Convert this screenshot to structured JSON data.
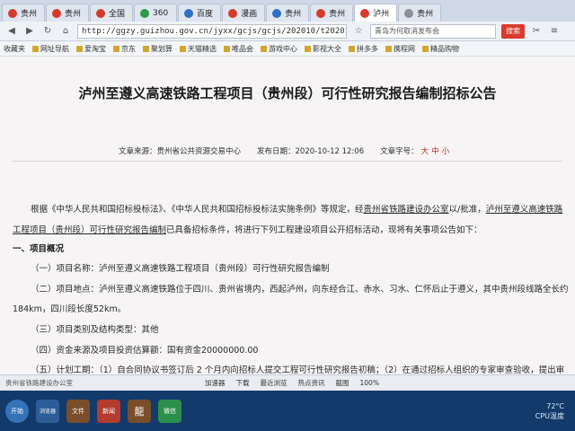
{
  "tabs": [
    {
      "label": "贵州",
      "color": "red"
    },
    {
      "label": "贵州",
      "color": "red"
    },
    {
      "label": "全国",
      "color": "red"
    },
    {
      "label": "360",
      "color": "green"
    },
    {
      "label": "百度",
      "color": "blue"
    },
    {
      "label": "漫画",
      "color": "red"
    },
    {
      "label": "贵州",
      "color": "blue"
    },
    {
      "label": "贵州",
      "color": "red"
    },
    {
      "label": "泸州",
      "color": "red"
    },
    {
      "label": "贵州",
      "color": "gray"
    }
  ],
  "nav": {
    "url": "http://ggzy.guizhou.gov.cn/jyxx/gcjs/gcjs/202010/t20201012_6399737",
    "search_placeholder": "青岛为何取消发布会",
    "search_button": "搜索"
  },
  "bookmarks": [
    "收藏夹",
    "网址导航",
    "爱淘宝",
    "京东",
    "聚划算",
    "天猫精选",
    "唯品会",
    "游戏中心",
    "影视大全",
    "拼多多",
    "携程网",
    "精品购物"
  ],
  "article": {
    "title": "泸州至遵义高速铁路工程项目（贵州段）可行性研究报告编制招标公告",
    "meta_source": "文章来源：贵州省公共资源交易中心",
    "meta_time": "发布日期：2020-10-12 12:06",
    "meta_size_label": "文章字号：",
    "size_big": "大",
    "size_mid": "中",
    "size_small": "小",
    "p1a": "根据《中华人民共和国招标投标法》、《中华人民共和国招标投标法实施条例》等规定，经",
    "p1b": "贵州省铁路建设办公室",
    "p1c": "以/批准，",
    "p1d": "泸州至遵义高速铁路",
    "p2a": "工程项目（贵州段）可行性研究报告编制",
    "p2b": "已具备招标条件，将进行下列工程建设项目公开招标活动，现将有关事项公告如下：",
    "h1": "一、项目概况",
    "i1": "（一）项目名称：泸州至遵义高速铁路工程项目（贵州段）可行性研究报告编制",
    "i2a": "（二）项目地点：泸州至遵义高速铁路位于四川、贵州省境内，西起泸州，向东经合江、赤水、习水、仁怀后止于遵义，其中贵州段线路全长约",
    "i2b": "184km，四川段长度52km。",
    "i3": "（三）项目类别及结构类型：其他",
    "i4": "（四）资金来源及项目投资估算额：国有资金20000000.00",
    "i5": "（五）计划工期：（1）自合同协议书签订后 2 个月内向招标人提交工程可行性研究报告初稿；（2）在通过招标人组织的专家审查验收，提出审"
  },
  "status": {
    "left": "贵州省铁路建设办公室",
    "items": [
      "加速器",
      "下载",
      "最近浏览",
      "热点资讯",
      "截图",
      "100%"
    ]
  },
  "taskbar": {
    "apps": [
      "开始",
      "浏览器",
      "文件",
      "新闻",
      "龍",
      "微信"
    ],
    "temp": "72°C",
    "temp_label": "CPU温度"
  }
}
